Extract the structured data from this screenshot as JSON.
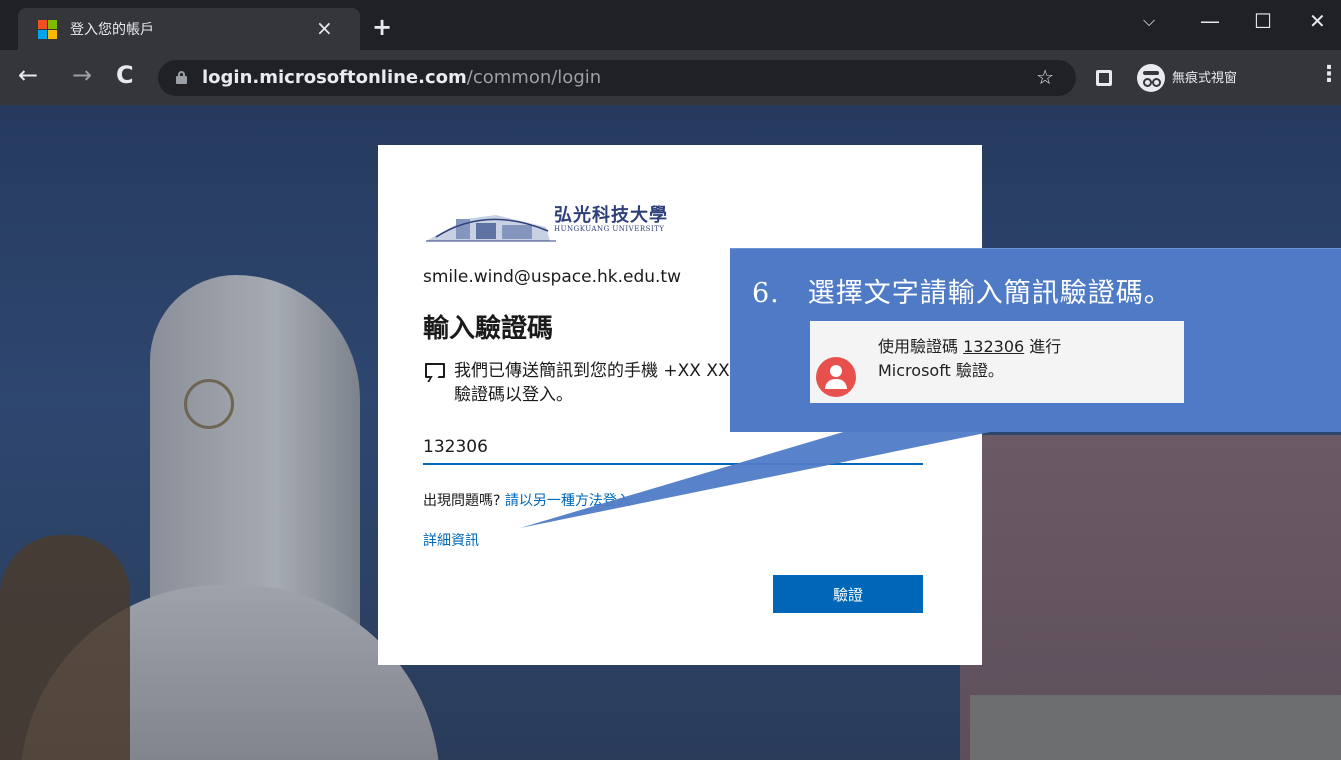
{
  "browser": {
    "tab_title": "登入您的帳戶",
    "tab_close": "×",
    "new_tab": "+",
    "window_controls": {
      "dropdown": "⌵",
      "minimize": "—",
      "maximize": "☐",
      "close": "✕"
    },
    "nav": {
      "back": "←",
      "forward": "→",
      "reload": "C"
    },
    "url_host": "login.microsoftonline.com",
    "url_path": "/common/login",
    "bookmark_star": "☆",
    "incognito_label": "無痕式視窗",
    "menu": "⋮",
    "favicon_colors": [
      "#f25022",
      "#7fba00",
      "#00a4ef",
      "#ffb900"
    ]
  },
  "login": {
    "logo_text": "弘光科技大學",
    "logo_subtext": "HUNGKUANG UNIVERSITY",
    "identity": "smile.wind@uspace.hk.edu.tw",
    "heading": "輸入驗證碼",
    "message": "我們已傳送簡訊到您的手機 +XX XXXXXXX12。請輸入驗證碼以登入。",
    "code_value": "132306",
    "trouble_text": "出現問題嗎? ",
    "trouble_link": "請以另一種方法登入",
    "more_info": "詳細資訊",
    "verify_button": "驗證",
    "accent_color": "#0067b8"
  },
  "callout": {
    "instruction": "6.　選擇文字請輸入簡訊驗證碼。",
    "sms_prefix": "使用驗證碼 ",
    "sms_code": "132306",
    "sms_suffix": " 進行",
    "sms_line2": "Microsoft 驗證。",
    "background_color": "#4f7bc6"
  }
}
